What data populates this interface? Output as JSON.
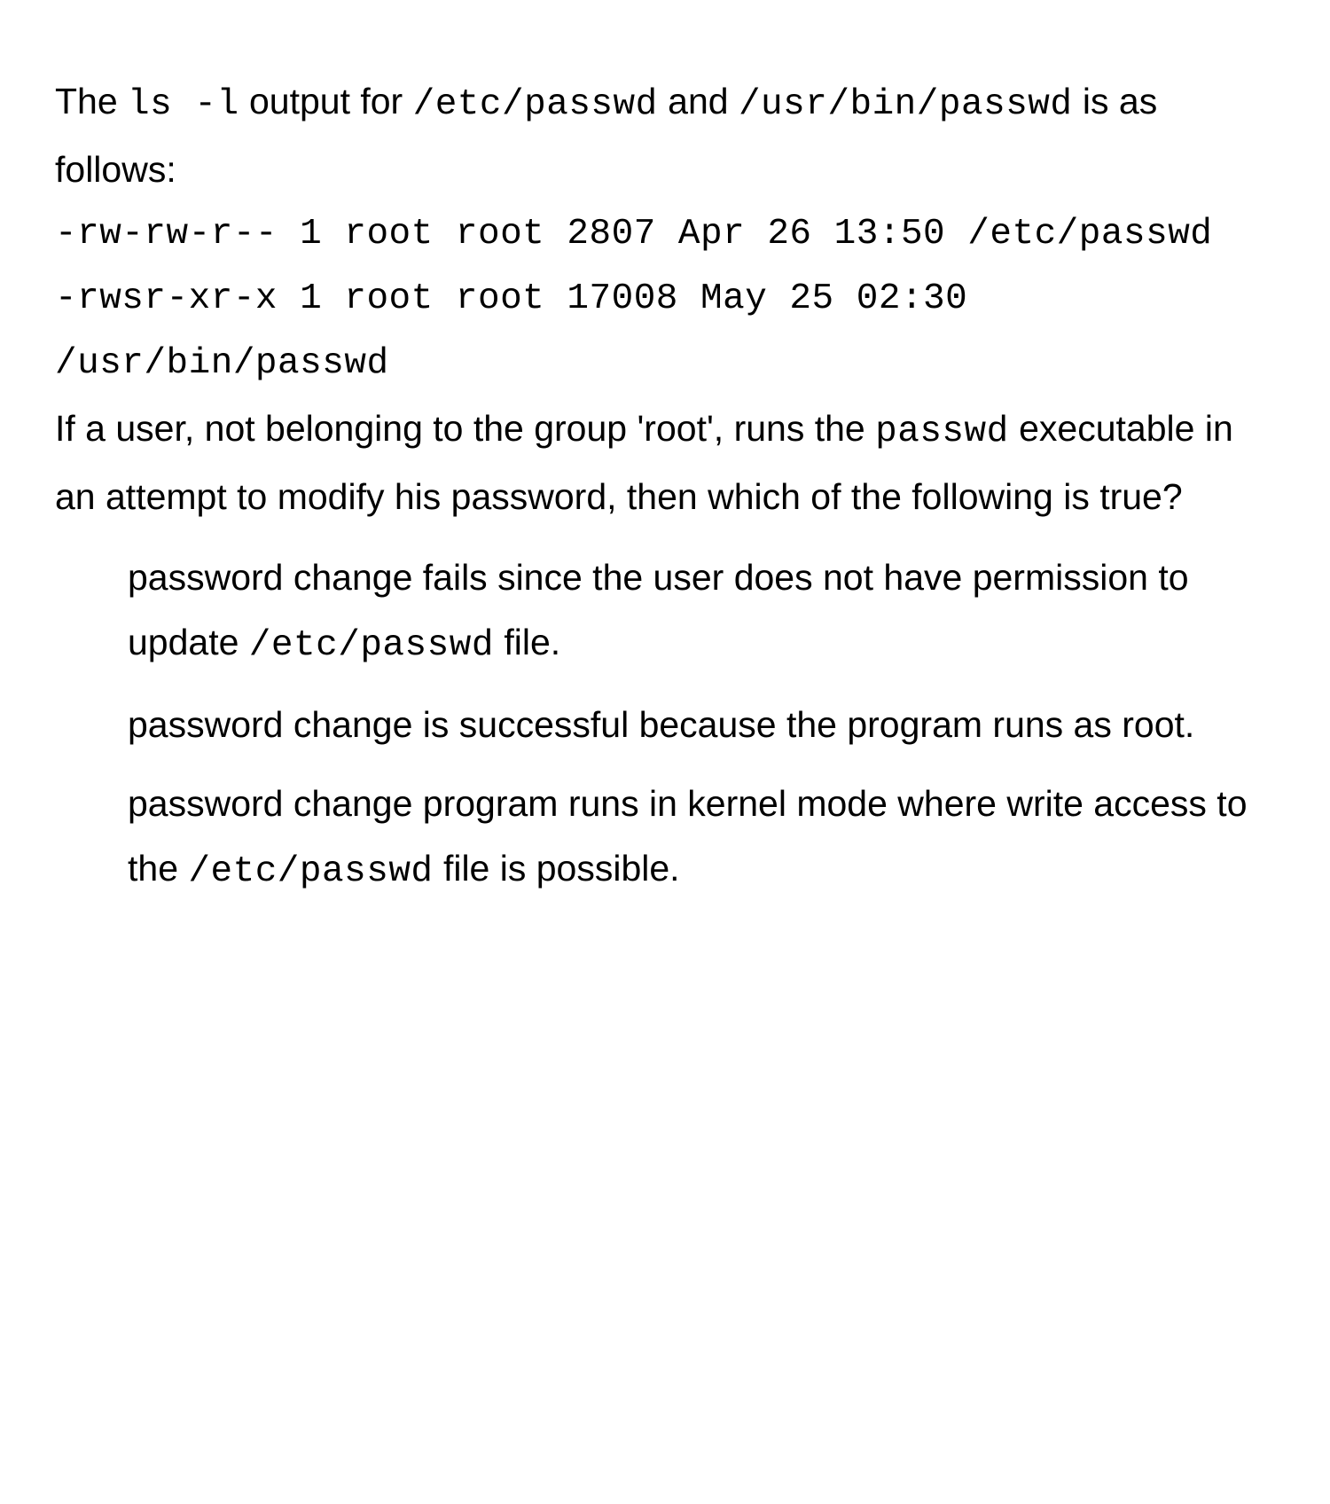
{
  "question": {
    "intro_pre": "The ",
    "cmd": "ls -l",
    "intro_mid": " output for ",
    "path1": "/etc/passwd",
    "intro_and": " and ",
    "path2": "/usr/bin/passwd",
    "intro_post": " is as follows:",
    "ls_line1": "-rw-rw-r-- 1 root root 2807 Apr 26 13:50 /etc/passwd",
    "ls_line2": "-rwsr-xr-x 1 root root 17008 May 25 02:30 /usr/bin/passwd",
    "sentence2_pre": "If a user, not belonging to the group 'root', runs the ",
    "sentence2_cmd": "passwd",
    "sentence2_post": " executable in an attempt to modify his password, then which of the following is true?"
  },
  "options": {
    "a": {
      "pre": "password change fails since the user does not have permission to update ",
      "code": "/etc/passwd",
      "post": " file."
    },
    "b": {
      "text": "password change is successful because the program runs as root."
    },
    "c": {
      "pre": "password change program runs in kernel mode where write access to the ",
      "code": "/etc/passwd",
      "post": " file is possible."
    }
  }
}
